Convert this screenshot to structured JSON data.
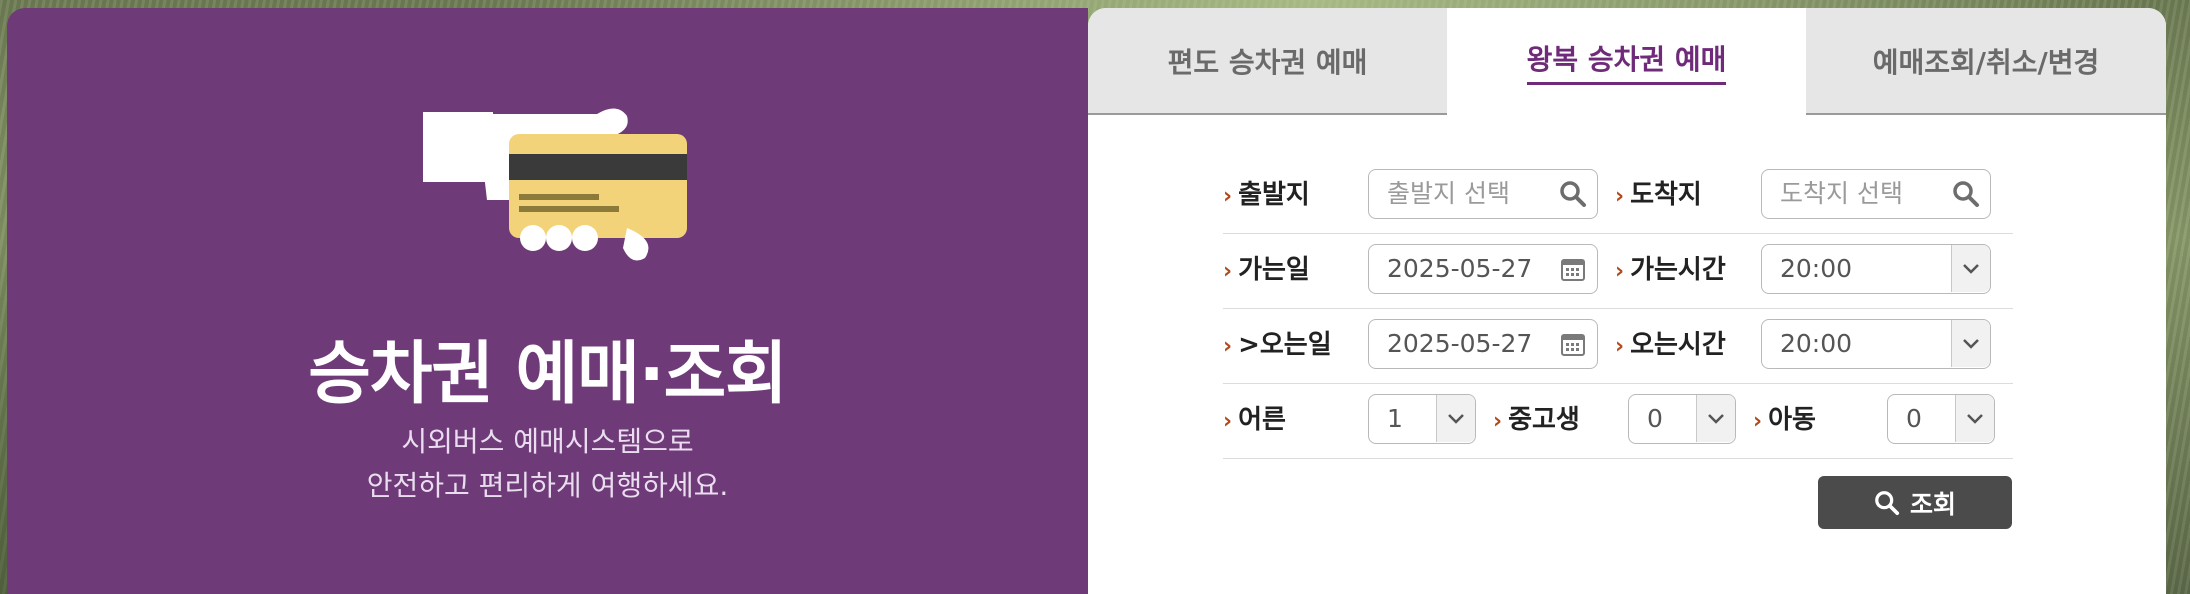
{
  "hero": {
    "title": "승차권 예매·조회",
    "subtitle_line1": "시외버스 예매시스템으로",
    "subtitle_line2": "안전하고 편리하게 여행하세요."
  },
  "tabs": [
    {
      "label": "편도 승차권 예매",
      "active": false
    },
    {
      "label": "왕복 승차권 예매",
      "active": true
    },
    {
      "label": "예매조회/취소/변경",
      "active": false
    }
  ],
  "form": {
    "departure": {
      "label": "출발지",
      "placeholder": "출발지 선택"
    },
    "arrival": {
      "label": "도착지",
      "placeholder": "도착지 선택"
    },
    "go_date": {
      "label": "가는일",
      "value": "2025-05-27"
    },
    "go_time": {
      "label": "가는시간",
      "value": "20:00"
    },
    "return_date": {
      "label": ">오는일",
      "value": "2025-05-27"
    },
    "return_time": {
      "label": "오는시간",
      "value": "20:00"
    },
    "adult": {
      "label": "어른",
      "value": "1"
    },
    "teen": {
      "label": "중고생",
      "value": "0"
    },
    "child": {
      "label": "아동",
      "value": "0"
    }
  },
  "search_button": {
    "label": "조회",
    "icon": "search-icon"
  },
  "colors": {
    "purple": "#6f3a78",
    "accent": "#6f2a7a",
    "button": "#4b4b4b",
    "chevron": "#b04a1a"
  }
}
